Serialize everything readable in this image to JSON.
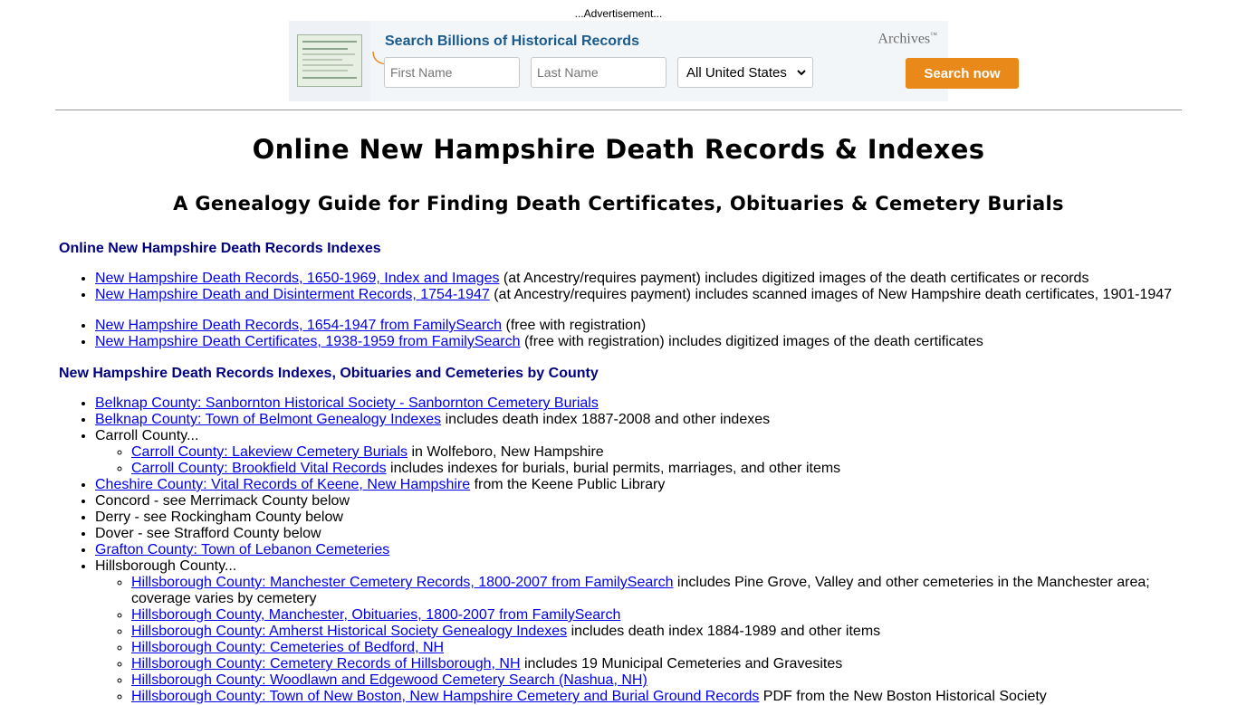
{
  "ad": {
    "label": "...Advertisement...",
    "title": "Search Billions of Historical Records",
    "brand": "Archives",
    "brand_mark": "™",
    "first_name_placeholder": "First Name",
    "last_name_placeholder": "Last Name",
    "state_selected": "All United States",
    "button_label": "Search now",
    "button_color": "#e8891a",
    "title_color": "#1b5a8c"
  },
  "page": {
    "title": "Online New Hampshire Death Records & Indexes",
    "subtitle": "A Genealogy Guide for Finding Death Certificates, Obituaries & Cemetery Burials"
  },
  "section1": {
    "heading": "Online New Hampshire Death Records Indexes",
    "items": [
      {
        "link": "New Hampshire Death Records, 1650-1969, Index and Images",
        "text": " (at Ancestry/requires payment) includes digitized images of the death certificates or records"
      },
      {
        "link": "New Hampshire Death and Disinterment Records, 1754-1947",
        "text": " (at Ancestry/requires payment) includes scanned images of New Hampshire death certificates, 1901-1947"
      }
    ],
    "items2": [
      {
        "link": "New Hampshire Death Records, 1654-1947 from FamilySearch",
        "text": " (free with registration)"
      },
      {
        "link": "New Hampshire Death Certificates, 1938-1959 from FamilySearch",
        "text": " (free with registration) includes digitized images of the death certificates"
      }
    ]
  },
  "section2": {
    "heading": "New Hampshire Death Records Indexes, Obituaries and Cemeteries by County",
    "belknap1": {
      "link": "Belknap County: Sanbornton Historical Society - Sanbornton Cemetery Burials",
      "text": ""
    },
    "belknap2": {
      "link": "Belknap County: Town of Belmont Genealogy Indexes",
      "text": " includes death index 1887-2008 and other indexes"
    },
    "carroll": {
      "label": "Carroll County...",
      "sub": [
        {
          "link": "Carroll County: Lakeview Cemetery Burials",
          "text": " in Wolfeboro, New Hampshire"
        },
        {
          "link": "Carroll County: Brookfield Vital Records",
          "text": " includes indexes for burials, burial permits, marriages, and other items"
        }
      ]
    },
    "cheshire": {
      "link": "Cheshire County: Vital Records of Keene, New Hampshire",
      "text": " from the Keene Public Library"
    },
    "concord": "Concord - see Merrimack County below",
    "derry": "Derry - see Rockingham County below",
    "dover": "Dover - see Strafford County below",
    "grafton": {
      "link": "Grafton County: Town of Lebanon Cemeteries",
      "text": ""
    },
    "hillsborough": {
      "label": "Hillsborough County...",
      "sub": [
        {
          "link": "Hillsborough County: Manchester Cemetery Records, 1800-2007 from FamilySearch",
          "text": " includes Pine Grove, Valley and other cemeteries in the Manchester area; coverage varies by cemetery"
        },
        {
          "link": "Hillsborough County, Manchester, Obituaries, 1800-2007 from FamilySearch",
          "text": ""
        },
        {
          "link": "Hillsborough County: Amherst Historical Society Genealogy Indexes",
          "text": " includes death index 1884-1989 and other items"
        },
        {
          "link": "Hillsborough County: Cemeteries of Bedford, NH",
          "text": ""
        },
        {
          "link": "Hillsborough County: Cemetery Records of Hillsborough, NH",
          "text": " includes 19 Municipal Cemeteries and Gravesites"
        },
        {
          "link": "Hillsborough County: Woodlawn and Edgewood Cemetery Search (Nashua, NH)",
          "text": ""
        },
        {
          "link": "Hillsborough County: Town of New Boston, New Hampshire Cemetery and Burial Ground Records",
          "text": " PDF from the New Boston Historical Society"
        }
      ]
    }
  }
}
